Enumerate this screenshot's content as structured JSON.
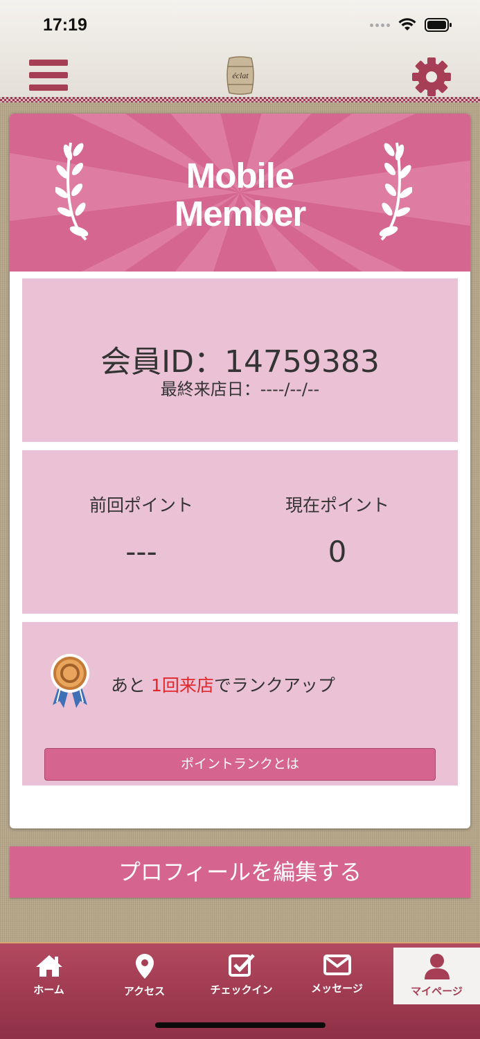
{
  "status_bar": {
    "time": "17:19"
  },
  "header": {
    "logo_text": "éclat",
    "menu_icon": "hamburger-menu-icon",
    "settings_icon": "gear-icon"
  },
  "banner": {
    "title_line1": "Mobile",
    "title_line2": "Member"
  },
  "member": {
    "id_label": "会員ID：",
    "id_value": "14759383",
    "last_visit_label": "最終来店日：",
    "last_visit_value": "----/--/--"
  },
  "points": {
    "previous_label": "前回ポイント",
    "previous_value": "---",
    "current_label": "現在ポイント",
    "current_value": "0"
  },
  "rank": {
    "text_prefix": "あと ",
    "highlight": "1回来店",
    "text_suffix": "でランクアップ",
    "button_label": "ポイントランクとは",
    "medal_icon": "bronze-medal-icon"
  },
  "profile_button_label": "プロフィールを編集する",
  "tabs": [
    {
      "label": "ホーム",
      "icon": "home-icon"
    },
    {
      "label": "アクセス",
      "icon": "map-pin-icon"
    },
    {
      "label": "チェックイン",
      "icon": "checkbox-icon"
    },
    {
      "label": "メッセージ",
      "icon": "envelope-icon"
    },
    {
      "label": "マイページ",
      "icon": "person-icon",
      "active": true
    }
  ],
  "colors": {
    "accent": "#d5658e",
    "panel": "#ebc2d5",
    "tabbar": "#a63e55",
    "highlight_text": "#e3262a"
  }
}
